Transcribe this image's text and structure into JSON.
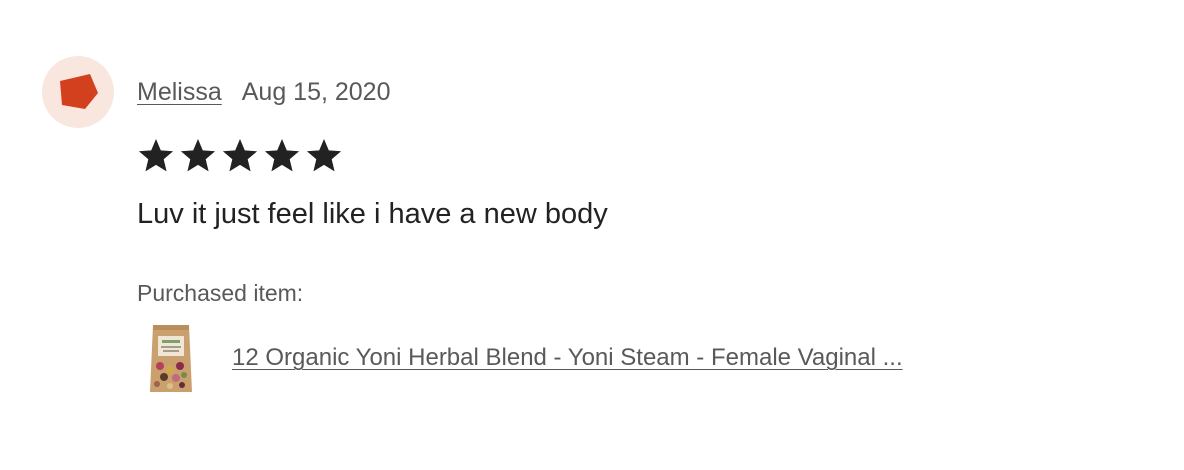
{
  "review": {
    "reviewer_name": "Melissa",
    "date": "Aug 15, 2020",
    "rating": 5,
    "rating_max": 5,
    "text": "Luv it just feel like i have a new body",
    "purchased_label": "Purchased item:",
    "item_title": "12 Organic Yoni Herbal Blend - Yoni Steam - Female Vaginal ..."
  },
  "avatar": {
    "icon": "pentagon-avatar-icon",
    "background_color": "#f9e6df",
    "shape_color": "#d2401d"
  },
  "colors": {
    "star": "#222222",
    "text_primary": "#222222",
    "text_secondary": "#595959"
  }
}
